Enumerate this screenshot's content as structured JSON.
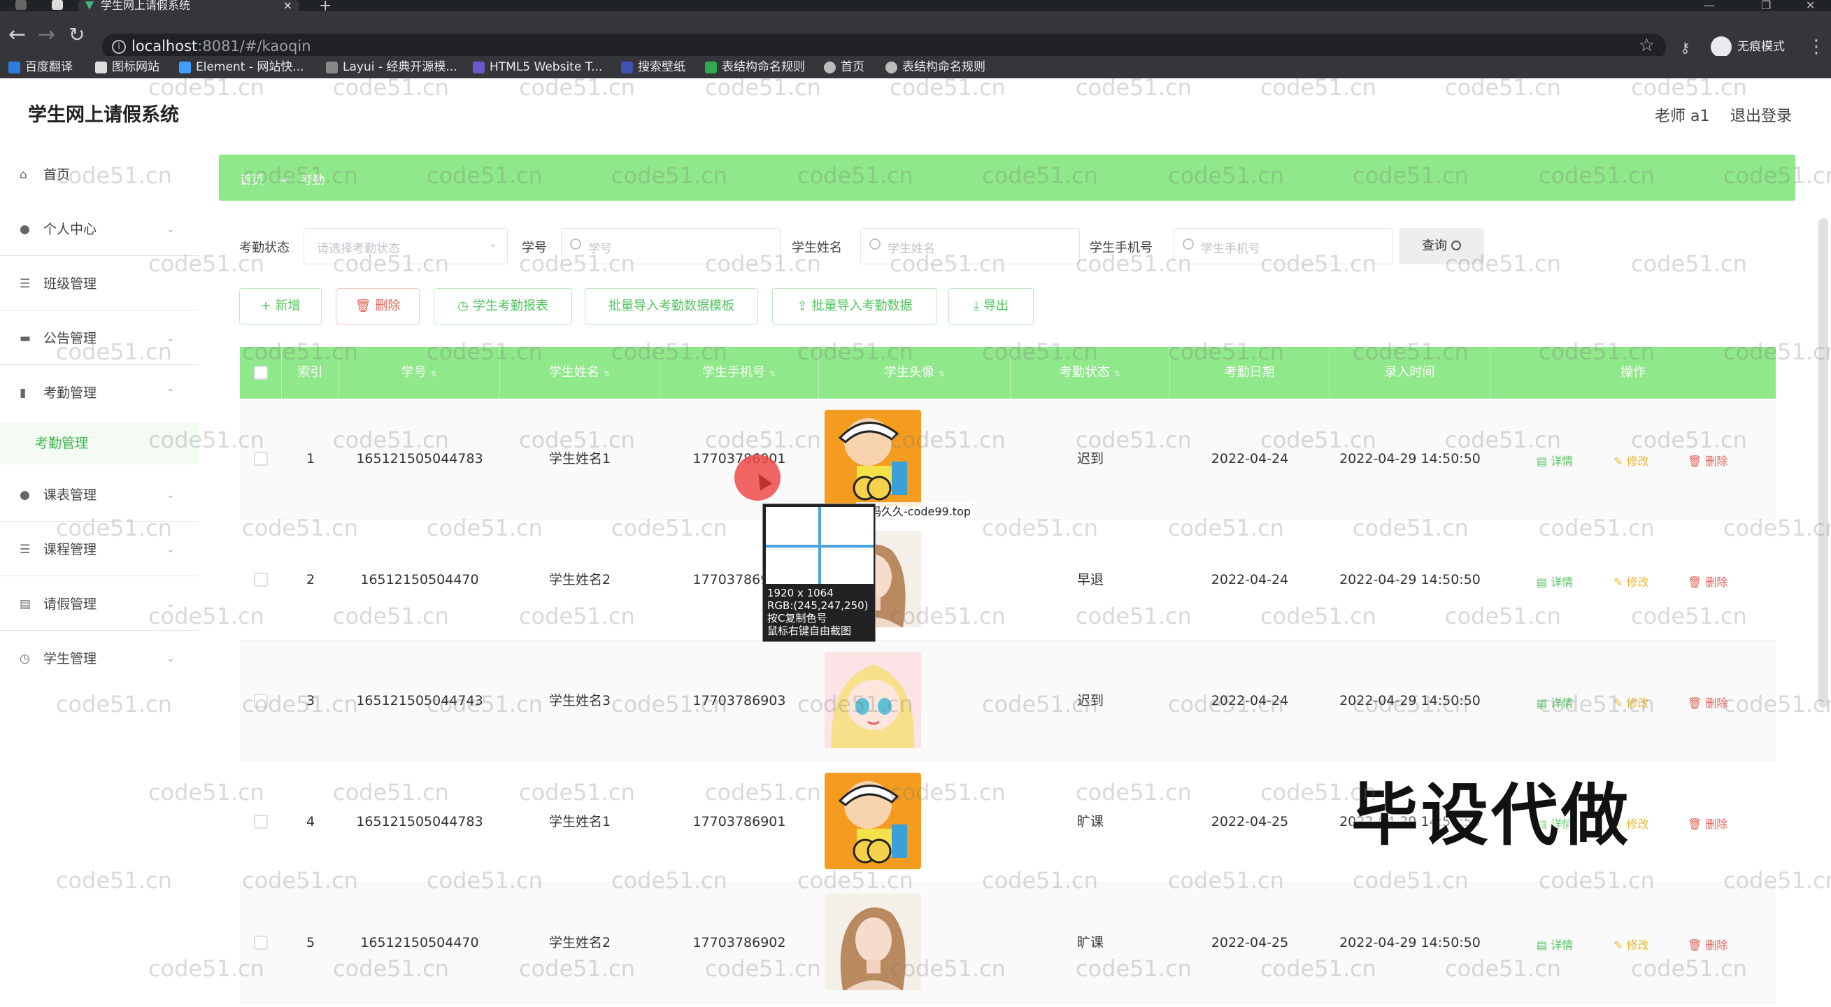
{
  "browser": {
    "tab_title": "学生网上请假系统",
    "url_host": "localhost",
    "url_rest": ":8081/#/kaoqin",
    "profile_label": "无痕模式",
    "bookmarks": [
      "百度翻译",
      "图标网站",
      "Element - 网站快...",
      "Layui - 经典开源模...",
      "HTML5 Website T...",
      "搜索壁纸",
      "表结构命名规则",
      "首页",
      "表结构命名规则"
    ]
  },
  "app": {
    "title": "学生网上请假系统",
    "user": "老师 a1",
    "logout": "退出登录"
  },
  "sidebar": {
    "items": [
      {
        "label": "首页"
      },
      {
        "label": "个人中心"
      },
      {
        "label": "班级管理"
      },
      {
        "label": "公告管理"
      },
      {
        "label": "考勤管理"
      },
      {
        "label": "考勤管理"
      },
      {
        "label": "课表管理"
      },
      {
        "label": "课程管理"
      },
      {
        "label": "请假管理"
      },
      {
        "label": "学生管理"
      }
    ]
  },
  "breadcrumb": {
    "home": "首页",
    "separator": "→",
    "current": "考勤"
  },
  "filters": {
    "status_label": "考勤状态",
    "status_placeholder": "请选择考勤状态",
    "sid_label": "学号",
    "sid_placeholder": "学号",
    "name_label": "学生姓名",
    "name_placeholder": "学生姓名",
    "phone_label": "学生手机号",
    "phone_placeholder": "学生手机号",
    "query_label": "查询"
  },
  "actions": {
    "add": "新增",
    "delete": "删除",
    "report": "学生考勤报表",
    "import_template": "批量导入考勤数据模板",
    "import": "批量导入考勤数据",
    "export": "导出"
  },
  "table": {
    "headers": [
      "索引",
      "学号",
      "学生姓名",
      "学生手机号",
      "学生头像",
      "考勤状态",
      "考勤日期",
      "录入时间",
      "操作"
    ],
    "op_labels": {
      "detail": "详情",
      "edit": "修改",
      "delete": "删除"
    },
    "rows": [
      {
        "index": "1",
        "sid": "165121505044783",
        "name": "学生姓名1",
        "phone": "17703786901",
        "status": "迟到",
        "date": "2022-04-24",
        "created": "2022-04-29 14:50:50"
      },
      {
        "index": "2",
        "sid": "16512150504470",
        "name": "学生姓名2",
        "phone": "17703786902",
        "status": "早退",
        "date": "2022-04-24",
        "created": "2022-04-29 14:50:50"
      },
      {
        "index": "3",
        "sid": "165121505044743",
        "name": "学生姓名3",
        "phone": "17703786903",
        "status": "迟到",
        "date": "2022-04-24",
        "created": "2022-04-29 14:50:50"
      },
      {
        "index": "4",
        "sid": "165121505044783",
        "name": "学生姓名1",
        "phone": "17703786901",
        "status": "旷课",
        "date": "2022-04-25",
        "created": "2022-04-29 14:50:50"
      },
      {
        "index": "5",
        "sid": "16512150504470",
        "name": "学生姓名2",
        "phone": "17703786902",
        "status": "旷课",
        "date": "2022-04-25",
        "created": "2022-04-29 14:50:50"
      }
    ]
  },
  "overlay": {
    "capture_tip": "源码久久-code99.top",
    "size": "1920 x 1064",
    "rgb": "RGB:(245,247,250)",
    "copy_hint": "按C复制色号",
    "right_click_hint": "鼠标右键自由截图",
    "big_watermark": "毕设代做",
    "watermark_text": "code51.cn"
  },
  "colors": {
    "accent_green": "#8fe88a",
    "text_green": "#52c45e",
    "danger": "#e2685f",
    "warning": "#e6b83a"
  }
}
